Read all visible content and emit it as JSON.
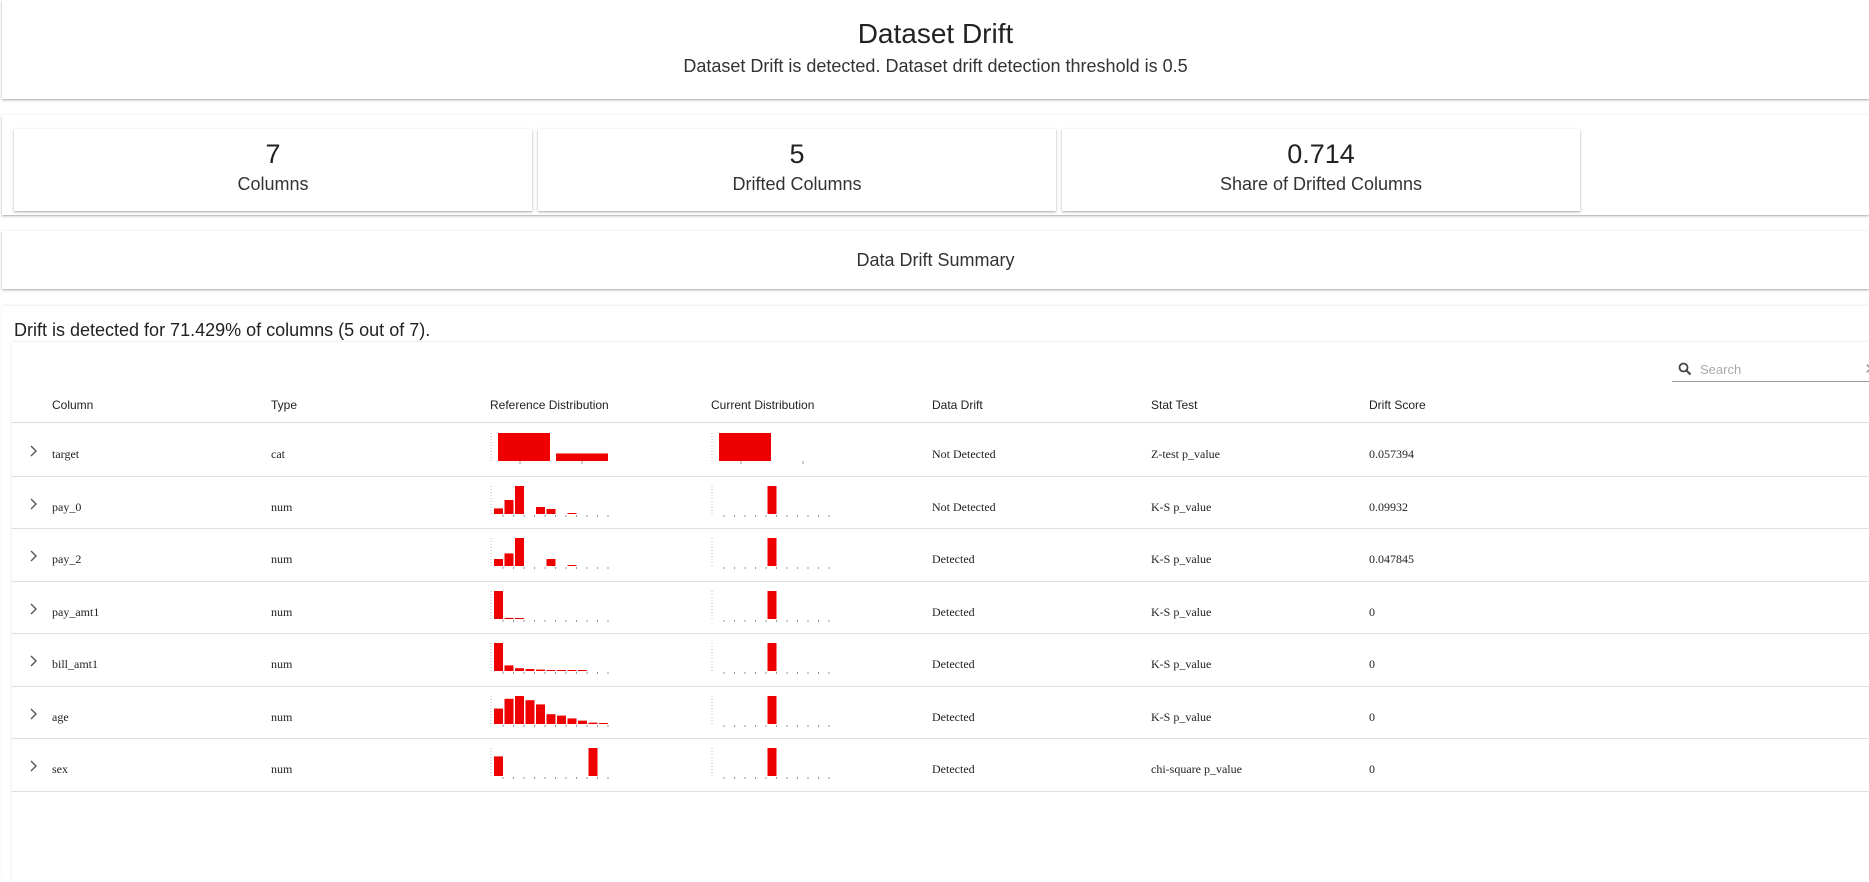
{
  "header": {
    "title": "Dataset Drift",
    "subtitle": "Dataset Drift is detected. Dataset drift detection threshold is 0.5"
  },
  "counters": [
    {
      "value": "7",
      "label": "Columns"
    },
    {
      "value": "5",
      "label": "Drifted Columns"
    },
    {
      "value": "0.714",
      "label": "Share of Drifted Columns"
    }
  ],
  "summary": {
    "title": "Data Drift Summary",
    "drift_text": "Drift is detected for 71.429% of columns (5 out of 7)."
  },
  "search": {
    "placeholder": "Search"
  },
  "table": {
    "headers": [
      "Column",
      "Type",
      "Reference Distribution",
      "Current Distribution",
      "Data Drift",
      "Stat Test",
      "Drift Score"
    ],
    "bar_color": "#ee0000",
    "rows": [
      {
        "column": "target",
        "type": "cat",
        "drift": "Not Detected",
        "stat_test": "Z-test p_value",
        "score": "0.057394",
        "ref": [
          1.0,
          0.27
        ],
        "cur": [
          1.0,
          0.0
        ]
      },
      {
        "column": "pay_0",
        "type": "num",
        "drift": "Not Detected",
        "stat_test": "K-S p_value",
        "score": "0.09932",
        "ref": [
          0.2,
          0.5,
          1.0,
          0,
          0.25,
          0.18,
          0,
          0.03,
          0,
          0,
          0
        ],
        "cur": [
          0,
          0,
          0,
          0,
          0,
          1.0,
          0,
          0,
          0,
          0,
          0
        ]
      },
      {
        "column": "pay_2",
        "type": "num",
        "drift": "Detected",
        "stat_test": "K-S p_value",
        "score": "0.047845",
        "ref": [
          0.25,
          0.45,
          1.0,
          0,
          0,
          0.25,
          0,
          0.03,
          0,
          0,
          0
        ],
        "cur": [
          0,
          0,
          0,
          0,
          0,
          1.0,
          0,
          0,
          0,
          0,
          0
        ]
      },
      {
        "column": "pay_amt1",
        "type": "num",
        "drift": "Detected",
        "stat_test": "K-S p_value",
        "score": "0",
        "ref": [
          1.0,
          0.04,
          0.01,
          0,
          0,
          0,
          0,
          0,
          0,
          0,
          0
        ],
        "cur": [
          0,
          0,
          0,
          0,
          0,
          1.0,
          0,
          0,
          0,
          0,
          0
        ]
      },
      {
        "column": "bill_amt1",
        "type": "num",
        "drift": "Detected",
        "stat_test": "K-S p_value",
        "score": "0",
        "ref": [
          1.0,
          0.2,
          0.1,
          0.07,
          0.05,
          0.03,
          0.03,
          0.02,
          0.01,
          0,
          0
        ],
        "cur": [
          0,
          0,
          0,
          0,
          0,
          1.0,
          0,
          0,
          0,
          0,
          0
        ]
      },
      {
        "column": "age",
        "type": "num",
        "drift": "Detected",
        "stat_test": "K-S p_value",
        "score": "0",
        "ref": [
          0.55,
          0.9,
          1.0,
          0.85,
          0.7,
          0.35,
          0.3,
          0.2,
          0.12,
          0.05,
          0.01
        ],
        "cur": [
          0,
          0,
          0,
          0,
          0,
          1.0,
          0,
          0,
          0,
          0,
          0
        ]
      },
      {
        "column": "sex",
        "type": "num",
        "drift": "Detected",
        "stat_test": "chi-square p_value",
        "score": "0",
        "ref": [
          0.7,
          0,
          0,
          0,
          0,
          0,
          0,
          0,
          0,
          1.0,
          0
        ],
        "cur": [
          0,
          0,
          0,
          0,
          0,
          1.0,
          0,
          0,
          0,
          0,
          0
        ]
      }
    ]
  }
}
